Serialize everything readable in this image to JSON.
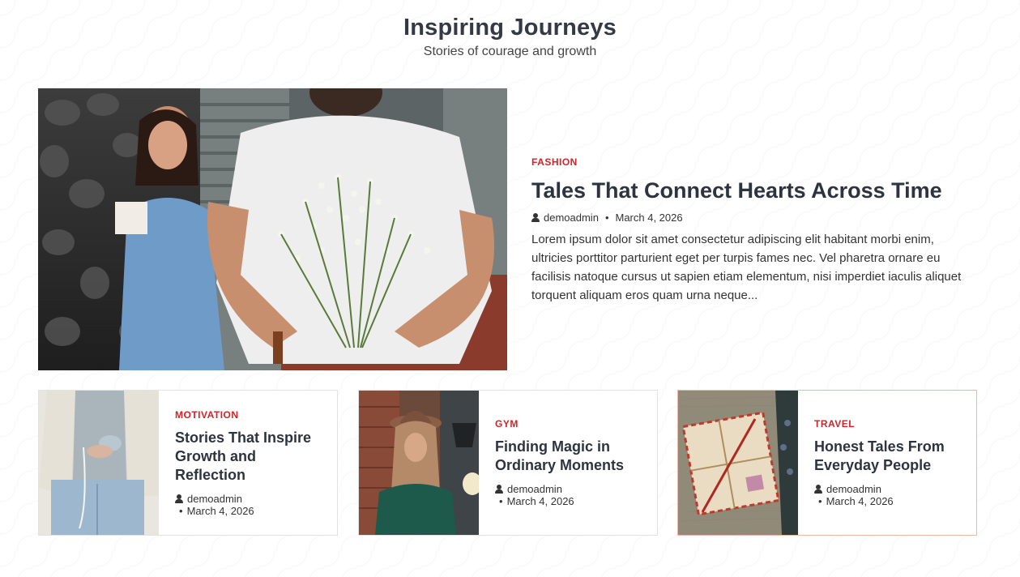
{
  "section": {
    "title": "Inspiring Journeys",
    "subtitle": "Stories of courage and growth"
  },
  "featured": {
    "category": "FASHION",
    "title": "Tales That Connect Hearts Across Time",
    "author": "demoadmin",
    "separator": "•",
    "date": "March 4, 2026",
    "excerpt": "Lorem ipsum dolor sit amet consectetur adipiscing elit habitant morbi enim, ultricies porttitor parturient eget per turpis fames nec. Vel pharetra ornare eu facilisis natoque cursus ut sapien etiam elementum, nisi imperdiet iaculis aliquet torquent aliquam eros quam urna neque...",
    "image_icon": "photo-couple-flowers"
  },
  "cards": [
    {
      "category": "MOTIVATION",
      "title": "Stories That Inspire Growth and Reflection",
      "author": "demoadmin",
      "separator": "•",
      "date": "March 4, 2026",
      "image_icon": "photo-woman-camera"
    },
    {
      "category": "GYM",
      "title": "Finding Magic in Ordinary Moments",
      "author": "demoadmin",
      "separator": "•",
      "date": "March 4, 2026",
      "image_icon": "photo-woman-hat"
    },
    {
      "category": "TRAVEL",
      "title": "Honest Tales From Everyday People",
      "author": "demoadmin",
      "separator": "•",
      "date": "March 4, 2026",
      "image_icon": "photo-letters"
    }
  ],
  "colors": {
    "accent": "#d0232a",
    "title": "#2d3440",
    "active_border": "#e9b9a8"
  }
}
